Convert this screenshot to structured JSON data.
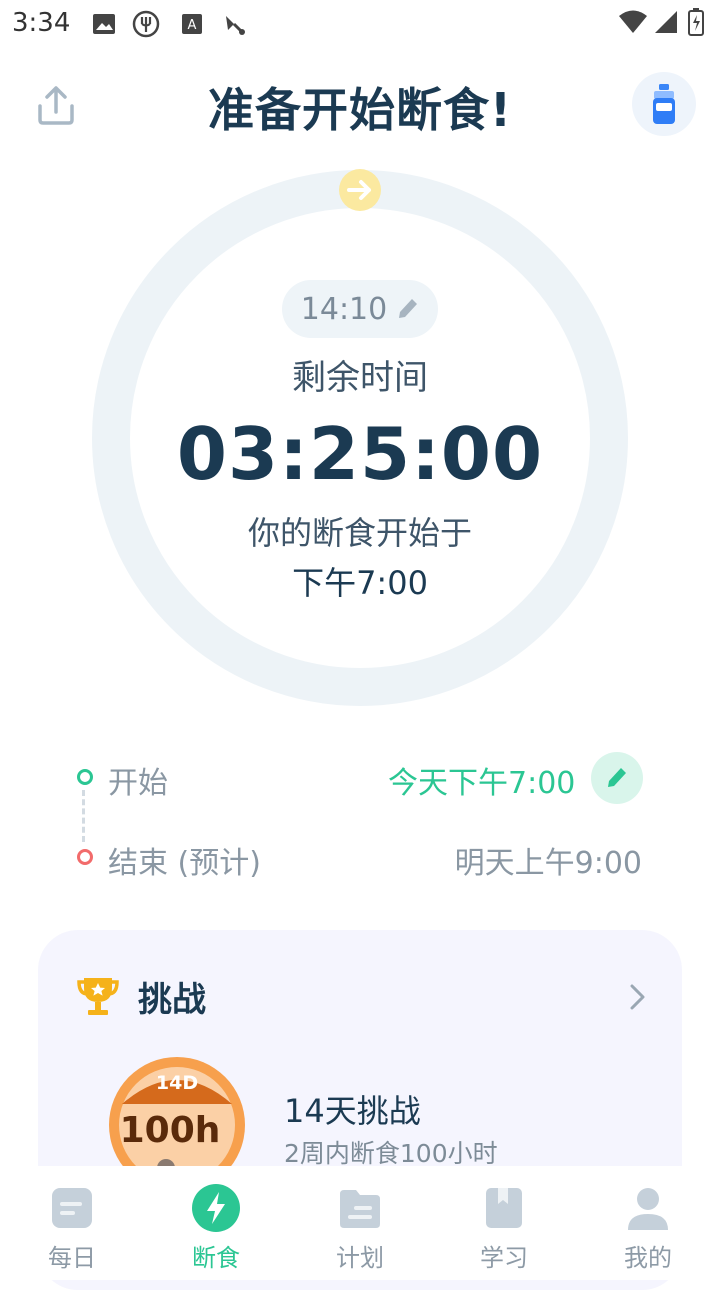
{
  "status_bar": {
    "time": "3:34"
  },
  "header": {
    "title": "准备开始断食!"
  },
  "timer": {
    "current_time": "14:10",
    "remaining_label": "剩余时间",
    "countdown": "03:25:00",
    "starts_label": "你的断食开始于",
    "starts_time": "下午7:00"
  },
  "schedule": {
    "start_label": "开始",
    "start_value": "今天下午7:00",
    "end_label": "结束 (预计)",
    "end_value": "明天上午9:00"
  },
  "challenge": {
    "section_title": "挑战",
    "name": "14天挑战",
    "description": "2周内断食100小时",
    "badge_top": "14D",
    "badge_main": "100h"
  },
  "nav": {
    "items": [
      {
        "label": "每日",
        "icon": "daily-icon"
      },
      {
        "label": "断食",
        "icon": "fasting-bolt-icon"
      },
      {
        "label": "计划",
        "icon": "plan-folder-icon"
      },
      {
        "label": "学习",
        "icon": "learn-book-icon"
      },
      {
        "label": "我的",
        "icon": "profile-icon"
      }
    ],
    "active_index": 1
  },
  "colors": {
    "accent_green": "#2bc693",
    "end_red": "#f26b6b",
    "title_navy": "#1b3a52",
    "ring": "#edf3f7",
    "arrow_yellow": "#fbe9a0"
  }
}
